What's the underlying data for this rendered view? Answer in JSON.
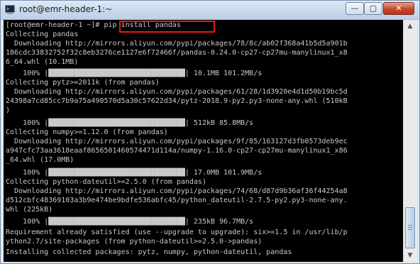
{
  "window": {
    "title": "root@emr-header-1:~",
    "icon": "terminal-icon",
    "minimize_label": "—",
    "maximize_label": "▢",
    "close_label": "✕",
    "colors": {
      "background": "#000000",
      "text": "#c9c9c9",
      "progress": "#c0c0c0",
      "highlight_border": "#e21818"
    }
  },
  "terminal": {
    "lines": [
      "[root@emr-header-1 ~]# pip install pandas",
      "Collecting pandas",
      "  Downloading http://mirrors.aliyun.com/pypi/packages/78/8c/ab02f368a41b5d5a901b",
      "186cdc33832752f32c8eb3276ce1127e6f72466f/pandas-0.24.0-cp27-cp27mu-manylinux1_x8",
      "6_64.whl (10.1MB)",
      "    100% |████████████████████████████████| 10.1MB 101.2MB/s",
      "Collecting pytz>=2011k (from pandas)",
      "  Downloading http://mirrors.aliyun.com/pypi/packages/61/28/1d3920e4d1d50b19bc5d",
      "24398a7cd85cc7b9a75a490570d5a30c57622d34/pytz-2018.9-py2.py3-none-any.whl (510kB",
      ")",
      "    100% |████████████████████████████████| 512kB 85.8MB/s",
      "Collecting numpy>=1.12.0 (from pandas)",
      "  Downloading http://mirrors.aliyun.com/pypi/packages/9f/85/163127d3fb0573deb9ec",
      "a947cfc73aa3618eaaf8656501460574471d114a/numpy-1.16.0-cp27-cp27mu-manylinux1_x86",
      "_64.whl (17.0MB)",
      "    100% |████████████████████████████████| 17.0MB 101.9MB/s",
      "Collecting python-dateutil>=2.5.0 (from pandas)",
      "  Downloading http://mirrors.aliyun.com/pypi/packages/74/68/d87d9b36af36f44254a8",
      "d512cbfc48369103a3b9e474be9bdfe536abfc45/python_dateutil-2.7.5-py2.py3-none-any.",
      "whl (225kB)",
      "    100% |████████████████████████████████| 235kB 96.7MB/s",
      "Requirement already satisfied (use --upgrade to upgrade): six>=1.5 in /usr/lib/p",
      "ython2.7/site-packages (from python-dateutil>=2.5.0->pandas)",
      "Installing collected packages: pytz, numpy, python-dateutil, pandas"
    ],
    "highlighted_command": "pip install pandas"
  }
}
